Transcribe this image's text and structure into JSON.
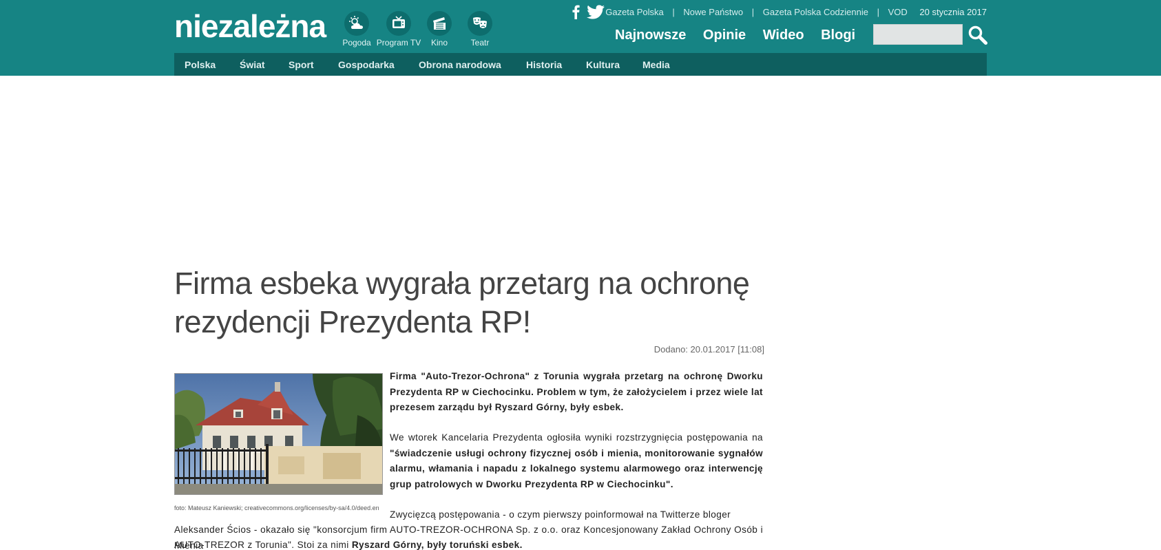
{
  "header": {
    "logo": "niezależna",
    "services": [
      {
        "label": "Pogoda",
        "icon": "weather-icon"
      },
      {
        "label": "Program TV",
        "icon": "tv-icon"
      },
      {
        "label": "Kino",
        "icon": "clapperboard-icon"
      },
      {
        "label": "Teatr",
        "icon": "theater-masks-icon"
      }
    ],
    "social": [
      "facebook-icon",
      "twitter-icon"
    ],
    "top_links": [
      "Gazeta Polska",
      "Nowe Państwo",
      "Gazeta Polska Codziennie",
      "VOD"
    ],
    "top_link_separator": "|",
    "date": "20 stycznia 2017",
    "main_nav": [
      "Najnowsze",
      "Opinie",
      "Wideo",
      "Blogi"
    ],
    "search": {
      "value": "",
      "placeholder": "",
      "icon": "search-icon"
    },
    "sub_nav": [
      "Polska",
      "Świat",
      "Sport",
      "Gospodarka",
      "Obrona narodowa",
      "Historia",
      "Kultura",
      "Media"
    ],
    "colors": {
      "header_bg": "#168484",
      "subnav_bg": "#0e5f5f"
    }
  },
  "article": {
    "title": "Firma esbeka wygrała przetarg na ochronę rezydencji Prezydenta RP!",
    "dateline": "Dodano: 20.01.2017 [11:08]",
    "photo_caption": "foto: Mateusz Kaniewski; creativecommons.org/licenses/by-sa/4.0/deed.en",
    "lead": "Firma \"Auto-Trezor-Ochrona\" z Torunia wygrała przetarg na ochronę Dworku Prezydenta RP w Ciechocinku. Problem w tym, że założycielem i przez wiele lat prezesem zarządu był Ryszard Górny, były esbek.",
    "p2_normal": "We wtorek Kancelaria Prezydenta ogłosiła wyniki rozstrzygnięcia postępowania na ",
    "p2_bold": "\"świadczenie usługi ochrony fizycznej osób i mienia, monitorowanie sygnałów alarmu, włamania i napadu z lokalnego systemu alarmowego oraz interwencję grup patrolowych w Dworku Prezydenta RP w Ciechocinku\".",
    "p3": "Zwycięzcą postępowania - o czym pierwszy poinformował na Twitterze bloger",
    "p4": "Aleksander Ścios - okazało się \"konsorcjum firm AUTO-TREZOR-OCHRONA Sp. z o.o. oraz Koncesjonowany Zakład Ochrony Osób i Mienia",
    "p5_normal": "AUTO-TREZOR z Torunia\". Stoi za nimi ",
    "p5_bold": "Ryszard Górny, były toruński esbek."
  }
}
